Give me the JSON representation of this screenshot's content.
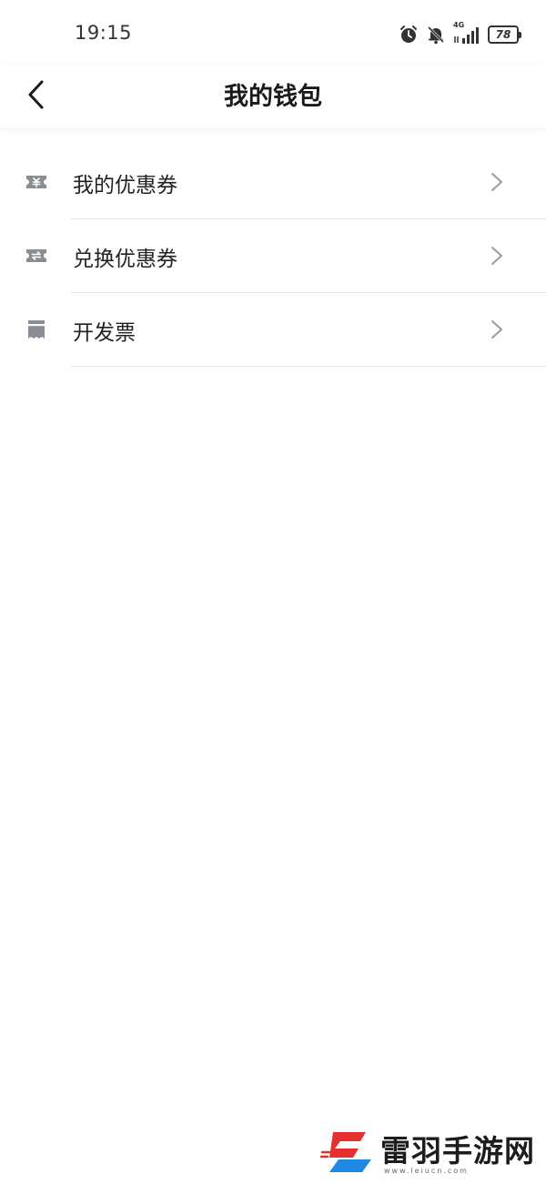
{
  "status_bar": {
    "time": "19:15",
    "network": "4G",
    "battery_level": "78",
    "icons": [
      "alarm-icon",
      "bell-muted-icon",
      "signal-icon",
      "battery-icon"
    ]
  },
  "header": {
    "title": "我的钱包",
    "back_icon": "chevron-left-icon"
  },
  "menu": {
    "items": [
      {
        "label": "我的优惠券",
        "icon": "coupon-icon"
      },
      {
        "label": "兑换优惠券",
        "icon": "exchange-coupon-icon"
      },
      {
        "label": "开发票",
        "icon": "invoice-icon"
      }
    ]
  },
  "watermark": {
    "text": "雷羽手游网",
    "sub": "www.leiucn.com"
  },
  "colors": {
    "background": "#ffffff",
    "text_primary": "#222222",
    "icon_gray": "#8a8d93",
    "divider": "#e6e6e6",
    "chevron": "#9a9a9a",
    "watermark_red": "#e63030",
    "watermark_blue": "#1e88e5"
  }
}
